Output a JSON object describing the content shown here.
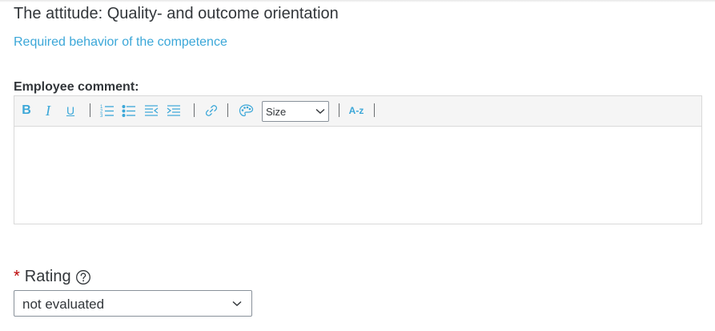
{
  "competency": {
    "title": "The attitude: Quality- and outcome orientation",
    "behavior_link": "Required behavior of the competence"
  },
  "comment": {
    "label": "Employee comment:",
    "toolbar": {
      "bold": "B",
      "italic": "I",
      "underline": "U",
      "size_value": "Size",
      "sort_label": "A-z"
    },
    "value": ""
  },
  "rating": {
    "required_marker": "*",
    "label": "Rating",
    "selected": "not evaluated"
  },
  "colors": {
    "link": "#3ba7d8",
    "text": "#32363a",
    "required": "#bb0000",
    "toolbar_bg": "#f5f5f5",
    "border": "#d9d9d9"
  },
  "icons": [
    "bold-icon",
    "italic-icon",
    "underline-icon",
    "numbered-list-icon",
    "bullet-list-icon",
    "outdent-icon",
    "indent-icon",
    "link-icon",
    "color-palette-icon",
    "chevron-down-icon",
    "sort-az-icon",
    "help-icon"
  ]
}
